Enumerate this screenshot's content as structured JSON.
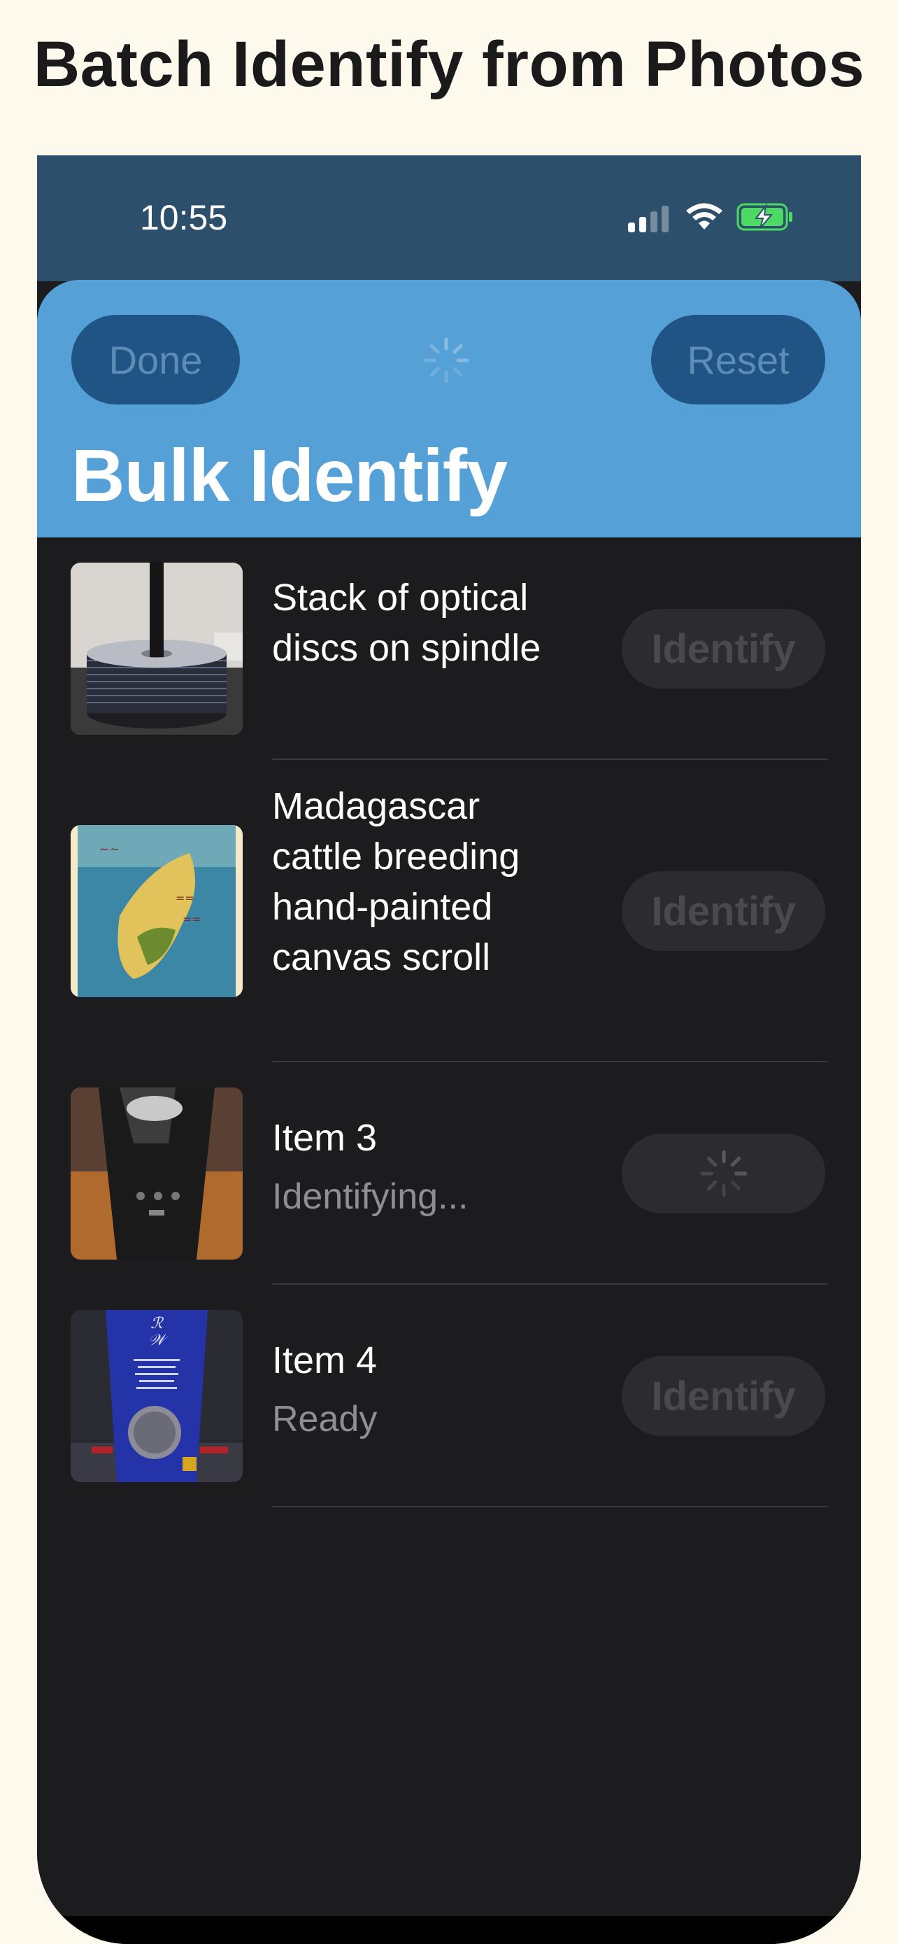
{
  "caption": "Batch Identify from Photos",
  "status_bar": {
    "time": "10:55",
    "icons": [
      "cellular-signal-icon",
      "wifi-icon",
      "battery-charging-icon"
    ]
  },
  "nav": {
    "done_label": "Done",
    "reset_label": "Reset",
    "title": "Bulk Identify",
    "loading": true
  },
  "items": [
    {
      "title": "Stack of optical discs on spindle",
      "subtitle": "",
      "button_label": "Identify",
      "state": "identified"
    },
    {
      "title": "Madagascar cattle breeding hand-painted canvas scroll",
      "subtitle": "",
      "button_label": "Identify",
      "state": "identified"
    },
    {
      "title": "Item 3",
      "subtitle": "Identifying...",
      "button_label": "",
      "state": "identifying"
    },
    {
      "title": "Item 4",
      "subtitle": "Ready",
      "button_label": "Identify",
      "state": "ready"
    }
  ],
  "colors": {
    "page_background": "#fdf9ec",
    "nav_background": "#55a0d6",
    "status_bar_background": "#2c4f6b",
    "list_background": "#1c1c1e",
    "button_background": "#2c2c2e",
    "secondary_text": "#8e8e93"
  }
}
